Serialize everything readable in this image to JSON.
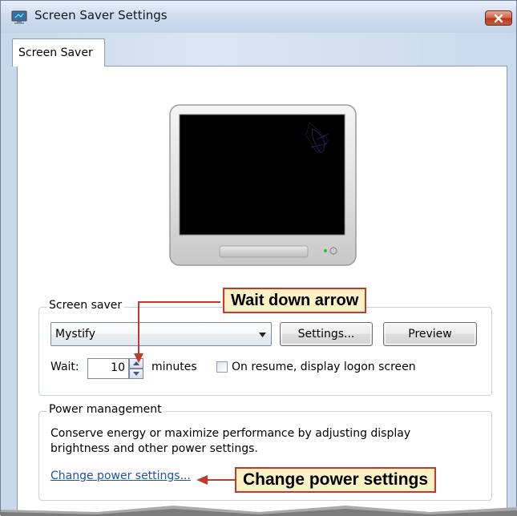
{
  "window": {
    "title": "Screen Saver Settings",
    "close_icon": "close-x-icon",
    "app_icon": "screensaver-monitor-icon"
  },
  "tabs": [
    {
      "label": "Screen Saver",
      "selected": true
    }
  ],
  "preview_monitor": {
    "icon": "monitor-preview-icon",
    "screen_color": "#000000"
  },
  "screen_saver": {
    "group_label": "Screen saver",
    "selected": "Mystify",
    "settings_label": "Settings...",
    "preview_label": "Preview",
    "wait_label": "Wait:",
    "wait_value": "10",
    "minutes_label": "minutes",
    "resume_checkbox_label": "On resume, display logon screen",
    "resume_checked": false
  },
  "power_management": {
    "group_label": "Power management",
    "description": "Conserve energy or maximize performance by adjusting display brightness and other power settings.",
    "link_text": "Change power settings..."
  },
  "callouts": {
    "wait_down_arrow": "Wait down arrow",
    "change_power_settings": "Change power settings"
  },
  "colors": {
    "callout_bg": "#fbf1c5",
    "callout_border": "#c0392b",
    "link": "#1c52b3",
    "close_button": "#c75a3c"
  }
}
